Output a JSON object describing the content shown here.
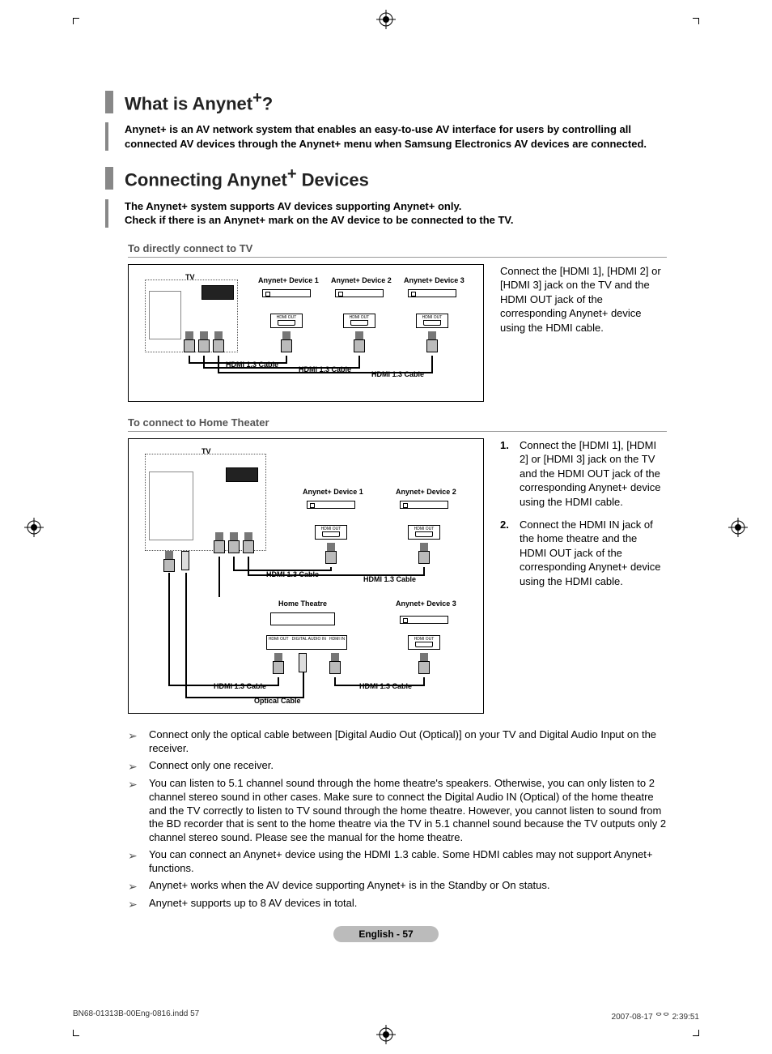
{
  "section1": {
    "heading_pre": "What is Anynet",
    "heading_sup": "+",
    "heading_post": "?",
    "desc": "Anynet+ is an AV network system that enables an easy-to-use AV interface for users by controlling all connected AV devices through the Anynet+ menu when Samsung Electronics AV devices are connected."
  },
  "section2": {
    "heading_pre": "Connecting Anynet",
    "heading_sup": "+",
    "heading_post": " Devices",
    "desc_line1": "The Anynet+ system supports AV devices supporting Anynet+ only.",
    "desc_line2": "Check if there is an Anynet+ mark on the AV device to be connected to the TV."
  },
  "subheading1": "To directly connect to TV",
  "diagram1": {
    "tv": "TV",
    "device1": "Anynet+ Device 1",
    "device2": "Anynet+ Device 2",
    "device3": "Anynet+ Device 3",
    "hdmi_out": "HDMI OUT",
    "cable1": "HDMI 1.3 Cable",
    "cable2": "HDMI 1.3 Cable",
    "cable3": "HDMI 1.3 Cable",
    "side_text": "Connect the [HDMI 1], [HDMI 2] or [HDMI 3] jack on the TV and the HDMI OUT jack of the corresponding Anynet+ device using the HDMI cable."
  },
  "subheading2": "To connect to Home Theater",
  "diagram2": {
    "tv": "TV",
    "device1": "Anynet+ Device 1",
    "device2": "Anynet+ Device 2",
    "device3": "Anynet+ Device 3",
    "home_theatre": "Home Theatre",
    "hdmi_out": "HDMI OUT",
    "hdmi_in": "HDMI IN",
    "digital_audio": "DIGITAL AUDIO IN",
    "cable1": "HDMI 1.3 Cable",
    "cable2": "HDMI 1.3 Cable",
    "cable3": "HDMI 1.3 Cable",
    "cable4": "HDMI 1.3 Cable",
    "optical": "Optical Cable",
    "steps": [
      {
        "num": "1.",
        "text": "Connect the [HDMI 1], [HDMI 2] or [HDMI 3] jack on the TV and the HDMI OUT jack of the corresponding Anynet+ device using the HDMI cable."
      },
      {
        "num": "2.",
        "text": "Connect the HDMI IN jack of the home theatre and the HDMI OUT jack of the corresponding Anynet+ device using the HDMI cable."
      }
    ]
  },
  "notes": [
    "Connect only the optical cable between [Digital Audio Out (Optical)] on your TV and Digital Audio Input on the receiver.",
    "Connect only one receiver.",
    "You can listen to 5.1 channel sound through the home theatre's speakers. Otherwise, you can only listen to 2 channel stereo sound in other cases. Make sure to connect the Digital Audio IN (Optical) of the home theatre and the TV correctly to listen to TV sound through the home theatre. However, you cannot listen to sound from the BD recorder that is sent to the home theatre via the TV in 5.1 channel sound because the TV outputs only 2 channel stereo sound. Please see the manual for the home theatre.",
    "You can connect an Anynet+ device using the HDMI 1.3 cable. Some HDMI cables may not support Anynet+ functions.",
    "Anynet+ works when the AV device supporting Anynet+ is in the Standby or On status.",
    "Anynet+ supports up to 8 AV devices in total."
  ],
  "page_badge": "English - 57",
  "footer": {
    "left": "BN68-01313B-00Eng-0816.indd   57",
    "right": "2007-08-17   ᄋᄋ 2:39:51"
  }
}
